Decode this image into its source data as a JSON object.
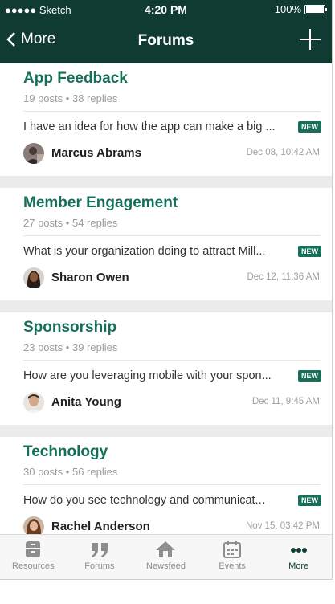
{
  "status_bar": {
    "carrier": "●●●●● Sketch",
    "time": "4:20 PM",
    "battery": "100%"
  },
  "nav": {
    "back_label": "More",
    "title": "Forums"
  },
  "forums": [
    {
      "title": "App Feedback",
      "posts": "19 posts",
      "replies": "38 replies",
      "snippet": "I have an idea for how the app can make a big ...",
      "badge": "NEW",
      "author": "Marcus Abrams",
      "date": "Dec 08, 10:42 AM"
    },
    {
      "title": "Member Engagement",
      "posts": "27 posts",
      "replies": "54 replies",
      "snippet": "What is your organization doing to attract Mill...",
      "badge": "NEW",
      "author": "Sharon Owen",
      "date": "Dec 12, 11:36 AM"
    },
    {
      "title": "Sponsorship",
      "posts": "23 posts",
      "replies": "39 replies",
      "snippet": "How are you leveraging mobile with your spon...",
      "badge": "NEW",
      "author": "Anita Young",
      "date": "Dec 11, 9:45 AM"
    },
    {
      "title": "Technology",
      "posts": "30 posts",
      "replies": "56 replies",
      "snippet": "How do you see technology and communicat...",
      "badge": "NEW",
      "author": "Rachel Anderson",
      "date": "Nov 15, 03:42 PM"
    }
  ],
  "meta_separator": "•",
  "tabs": [
    {
      "label": "Resources",
      "icon": "resources-icon"
    },
    {
      "label": "Forums",
      "icon": "quote-icon"
    },
    {
      "label": "Newsfeed",
      "icon": "home-icon"
    },
    {
      "label": "Events",
      "icon": "calendar-icon"
    },
    {
      "label": "More",
      "icon": "more-dots-icon"
    }
  ],
  "colors": {
    "header_bg": "#0f3b32",
    "accent": "#166f58",
    "tab_active": "#0f3b32"
  }
}
